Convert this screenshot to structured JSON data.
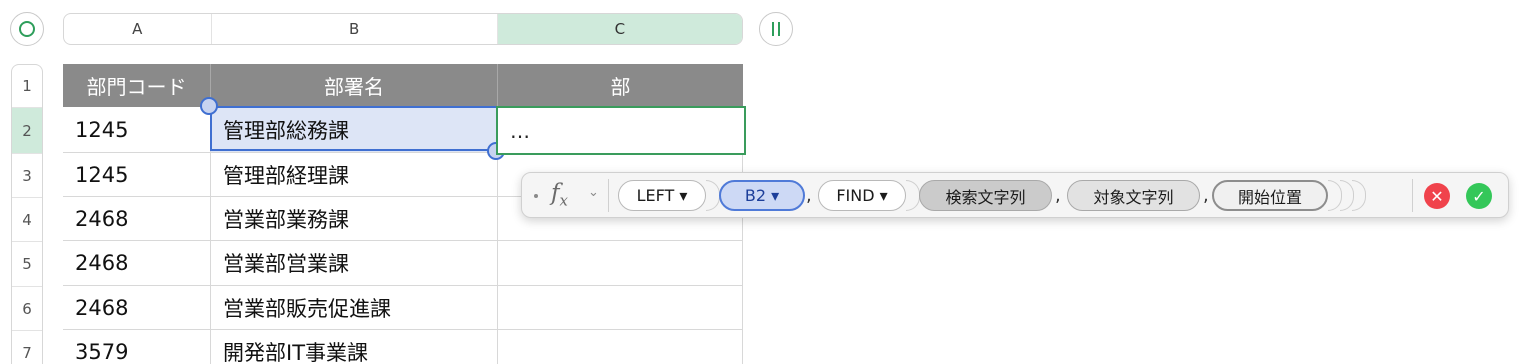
{
  "columns": {
    "a": "A",
    "b": "B",
    "c": "C"
  },
  "rows": [
    "1",
    "2",
    "3",
    "4",
    "5",
    "6",
    "7"
  ],
  "table": {
    "headers": [
      "部門コード",
      "部署名",
      "部"
    ],
    "cells": [
      [
        "1245",
        "管理部総務課",
        "…"
      ],
      [
        "1245",
        "管理部経理課",
        ""
      ],
      [
        "2468",
        "営業部業務課",
        ""
      ],
      [
        "2468",
        "営業部営業課",
        ""
      ],
      [
        "2468",
        "営業部販売促進課",
        ""
      ],
      [
        "3579",
        "開発部IT事業課",
        ""
      ]
    ]
  },
  "formula_bar": {
    "fx_label": "f",
    "fx_sub": "x",
    "fx_menu": "⌄",
    "func1": "LEFT ▾",
    "ref": "B2 ▾",
    "func2": "FIND ▾",
    "arg1": "検索文字列",
    "arg2": "対象文字列",
    "arg3": "開始位置",
    "comma": ",",
    "cancel": "✕",
    "accept": "✓"
  },
  "colors": {
    "selected_column": "#cfeadb",
    "header_bg": "#8a8a8a",
    "selection_blue": "#3f6fd1",
    "active_green": "#3a9c5c"
  }
}
